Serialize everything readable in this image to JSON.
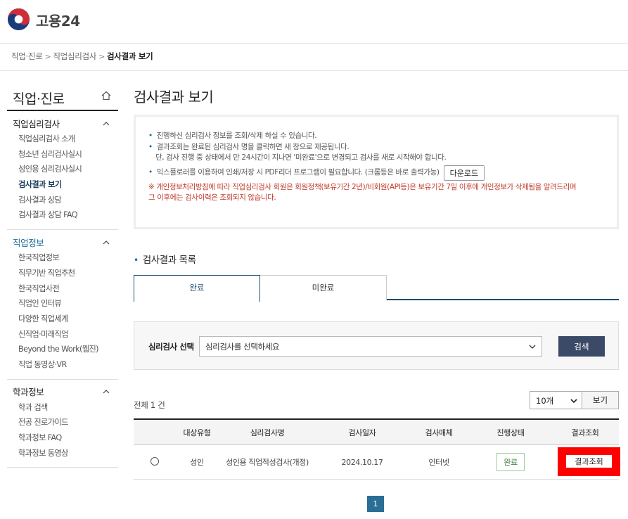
{
  "header": {
    "logo_text": "고용24"
  },
  "breadcrumb": {
    "item1": "직업·진로",
    "item2": "직업심리검사",
    "current": "검사결과 보기",
    "sep": ">"
  },
  "sidebar": {
    "title": "직업·진로",
    "sections": [
      {
        "label": "직업심리검사",
        "items": [
          "직업심리검사 소개",
          "청소년 심리검사실시",
          "성인용 심리검사실시",
          "검사결과 보기",
          "검사결과 상담",
          "검사결과 상담 FAQ"
        ]
      },
      {
        "label": "직업정보",
        "items": [
          "한국직업정보",
          "직무기반 직업추천",
          "한국직업사전",
          "직업인 인터뷰",
          "다양한 직업세계",
          "신직업·미래직업",
          "Beyond the Work(웹진)",
          "직업 동영상·VR"
        ]
      },
      {
        "label": "학과정보",
        "items": [
          "학과 검색",
          "전공 진로가이드",
          "학과정보 FAQ",
          "학과정보 동영상"
        ]
      }
    ]
  },
  "main": {
    "title": "검사결과 보기",
    "info": {
      "line1": "진행하신 심리검사 정보를 조회/삭제 하실 수 있습니다.",
      "line2": "결과조회는 완료된 심리검사 명을 클릭하면 새 창으로 제공됩니다.",
      "line3": "단, 검사 진행 중 상태에서 만 24시간이 지나면 '미완료'으로 변경되고 검사를 새로 시작해야 합니다.",
      "line4": "익스플로러를 이용하여 인쇄/저장 시 PDF리더 프로그램이 필요합니다. (크롬등은 바로 출력가능)",
      "download_label": "다운로드",
      "notice1": "※ 개인정보처리방침에 따라 직업심리검사 회원은 회원정책(보유기간 2년)/비회원(API등)은 보유기간 7일 이후에 개인정보가 삭제됨을 알려드리며",
      "notice2": "그 이후에는 검사이력은 조회되지 않습니다."
    },
    "list_title": "검사결과 목록",
    "tabs": [
      "완료",
      "미완료"
    ],
    "search": {
      "label": "심리검사 선택",
      "select_value": "심리검사를 선택하세요",
      "button": "검색"
    },
    "total": "전체 1 건",
    "page_size": "10개",
    "view_button": "보기",
    "table": {
      "headers": [
        "대상유형",
        "심리검사명",
        "검사일자",
        "검사매체",
        "진행상태",
        "결과조회"
      ],
      "rows": [
        {
          "target": "성인",
          "name": "성인용 직업적성검사(개정)",
          "date": "2024.10.17",
          "media": "인터넷",
          "status": "완료",
          "result": "결과조회"
        }
      ]
    },
    "page": "1"
  },
  "colors": {
    "accent": "#1d6a96",
    "button_dark": "#3b4a66",
    "highlight": "#ff0000",
    "page_active": "#2a6e96"
  }
}
